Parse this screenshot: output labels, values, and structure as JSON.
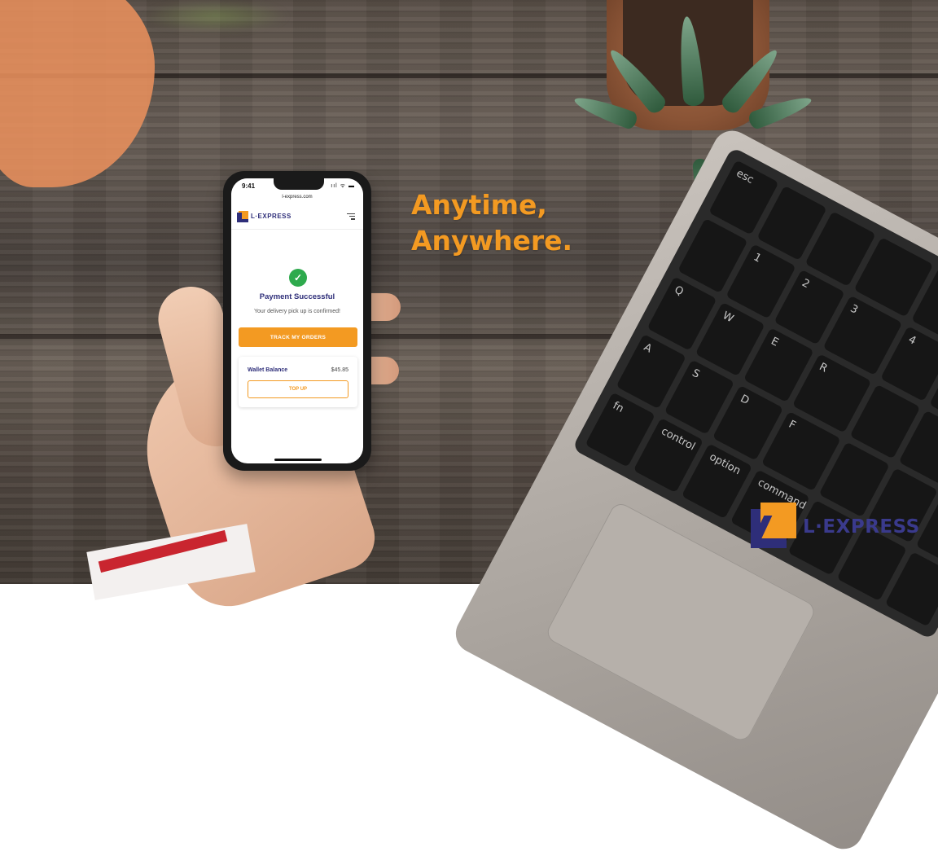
{
  "phone": {
    "status_time": "9:41",
    "status_icons": "ııl ᯤ ▬",
    "url": "l-express.com",
    "app_name": "L·EXPRESS",
    "payment_title": "Payment Successful",
    "payment_subtitle": "Your delivery pick up is confirmed!",
    "track_button": "TRACK MY ORDERS",
    "wallet_label": "Wallet Balance",
    "wallet_amount": "$45.85",
    "topup_button": "TOP UP"
  },
  "headline": {
    "line1": "Anytime,",
    "line2": "Anywhere."
  },
  "brand": {
    "name": "L·EXPRESS"
  },
  "keyboard": {
    "keys": [
      "esc",
      "",
      "",
      "",
      "",
      "",
      "",
      "",
      "1",
      "2",
      "3",
      "4",
      "",
      "",
      "Q",
      "W",
      "E",
      "R",
      "",
      "",
      "",
      "A",
      "S",
      "D",
      "F",
      "",
      "",
      "",
      "fn",
      "control",
      "option",
      "command",
      "",
      "",
      ""
    ]
  },
  "colors": {
    "accent": "#f39a22",
    "navy": "#2e2e79",
    "success": "#2eaa4d"
  }
}
